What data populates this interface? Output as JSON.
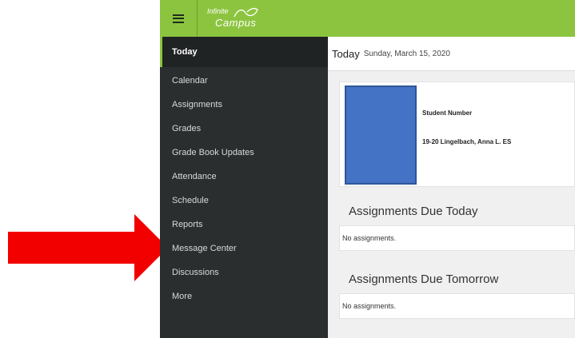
{
  "colors": {
    "brand_green": "#8cc43f",
    "sidebar_bg": "#2b2e2f",
    "arrow_red": "#f20000",
    "photo_blue": "#4472c4"
  },
  "header": {
    "logo_line1": "Infinite",
    "logo_line2": "Campus",
    "menu_icon": "hamburger-icon"
  },
  "sidebar": {
    "items": [
      {
        "label": "Today"
      },
      {
        "label": "Calendar"
      },
      {
        "label": "Assignments"
      },
      {
        "label": "Grades"
      },
      {
        "label": "Grade Book Updates"
      },
      {
        "label": "Attendance"
      },
      {
        "label": "Schedule"
      },
      {
        "label": "Reports"
      },
      {
        "label": "Message Center"
      },
      {
        "label": "Discussions"
      },
      {
        "label": "More"
      }
    ]
  },
  "main": {
    "title": "Today",
    "date": "Sunday, March 15, 2020",
    "student": {
      "label": "Student Number",
      "name": "19-20 Lingelbach, Anna L. ES"
    },
    "due_today": {
      "heading": "Assignments Due Today",
      "empty": "No assignments."
    },
    "due_tomorrow": {
      "heading": "Assignments Due Tomorrow",
      "empty": "No assignments."
    }
  }
}
